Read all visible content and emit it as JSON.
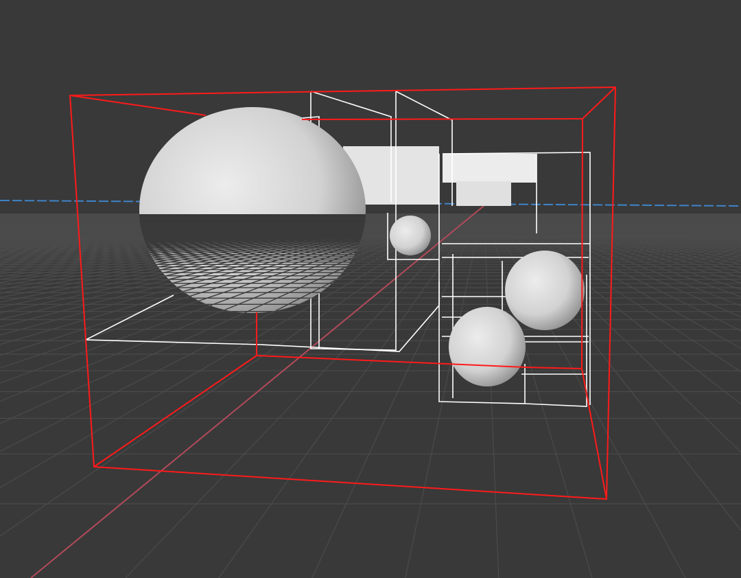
{
  "viewport": {
    "view": "3d-perspective",
    "colors": {
      "background": "#393939",
      "grid": "#4b4b4b",
      "x_axis": "#b34a5a",
      "y_axis": "#3f84c8",
      "selected_bounds": "#ff1a1a",
      "wireframe": "#ffffff",
      "solid": "#e6e6e6"
    },
    "objects": [
      {
        "name": "sphere-large",
        "type": "sphere"
      },
      {
        "name": "sphere-small-back",
        "type": "sphere"
      },
      {
        "name": "sphere-right-upper",
        "type": "sphere"
      },
      {
        "name": "sphere-right-lower",
        "type": "sphere"
      },
      {
        "name": "box-solid-back",
        "type": "box"
      },
      {
        "name": "bounding-box-selected",
        "type": "wire-box"
      }
    ]
  }
}
